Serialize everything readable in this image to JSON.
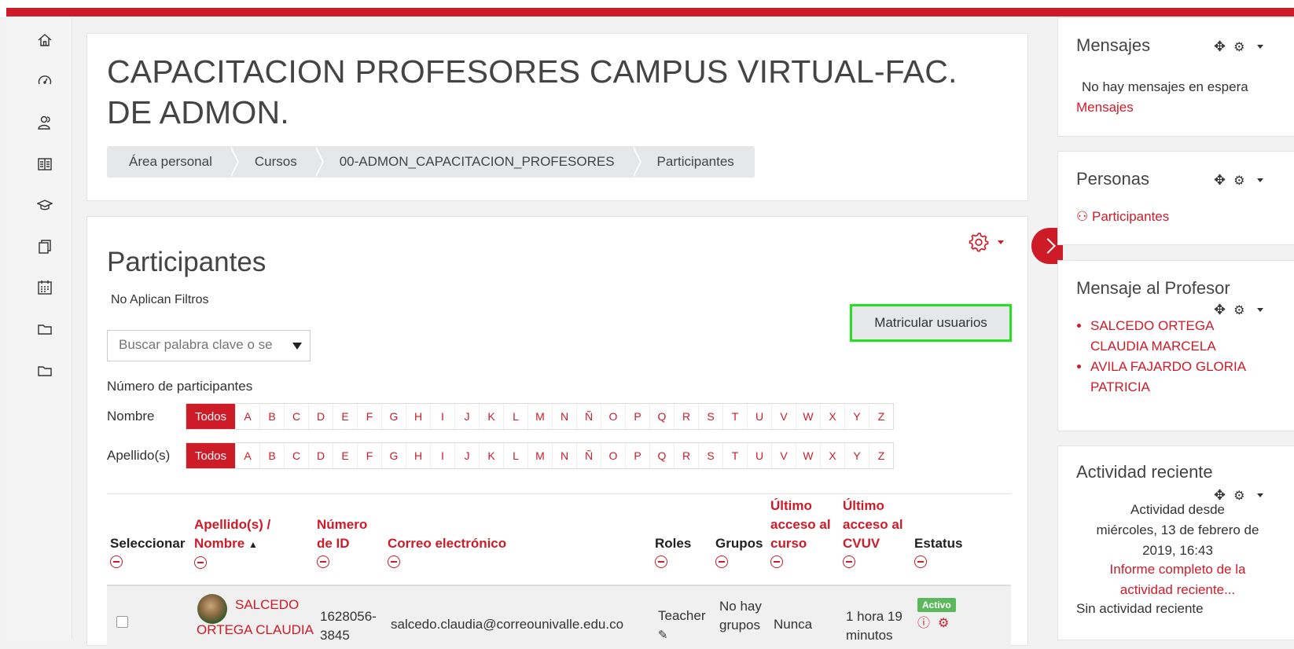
{
  "course": {
    "title": "CAPACITACION PROFESORES CAMPUS VIRTUAL-FAC. DE ADMON.",
    "breadcrumb": [
      "Área personal",
      "Cursos",
      "00-ADMON_CAPACITACION_PROFESORES",
      "Participantes"
    ]
  },
  "nav_icons": [
    "home-icon",
    "dashboard-icon",
    "participants-icon",
    "grades-icon",
    "education-icon",
    "resources-icon",
    "calendar-icon",
    "folder-icon",
    "folder-icon"
  ],
  "participants": {
    "heading": "Participantes",
    "no_filters": "No Aplican Filtros",
    "search_placeholder": "Buscar palabra clave o se",
    "enrol_button": "Matricular usuarios",
    "count_label": "Número de participantes",
    "first_name_label": "Nombre",
    "last_name_label": "Apellido(s)",
    "all_label": "Todos",
    "letters": [
      "A",
      "B",
      "C",
      "D",
      "E",
      "F",
      "G",
      "H",
      "I",
      "J",
      "K",
      "L",
      "M",
      "N",
      "Ñ",
      "O",
      "P",
      "Q",
      "R",
      "S",
      "T",
      "U",
      "V",
      "W",
      "X",
      "Y",
      "Z"
    ],
    "columns": {
      "select": "Seleccionar",
      "name_line1": "Apellido(s) /",
      "name_line2": "Nombre",
      "id_line1": "Número",
      "id_line2": "de ID",
      "email": "Correo electrónico",
      "roles": "Roles",
      "groups": "Grupos",
      "course_access_line1": "Último",
      "course_access_line2": "acceso al",
      "course_access_line3": "curso",
      "cvuv_access_line1": "Último",
      "cvuv_access_line2": "acceso al",
      "cvuv_access_line3": "CVUV",
      "status": "Estatus"
    },
    "row": {
      "name_line1": "SALCEDO",
      "name_line2": "ORTEGA CLAUDIA",
      "id_line1": "1628056-",
      "id_line2": "3845",
      "email": "salcedo.claudia@correounivalle.edu.co",
      "role": "Teacher",
      "groups_line1": "No hay",
      "groups_line2": "grupos",
      "course_access": "Nunca",
      "cvuv_access_line1": "1 hora 19",
      "cvuv_access_line2": "minutos",
      "status": "Activo"
    }
  },
  "blocks": {
    "messages": {
      "title": "Mensajes",
      "text": "No hay mensajes en espera",
      "link": "Mensajes"
    },
    "people": {
      "title": "Personas",
      "link": "Participantes"
    },
    "teacher_msg": {
      "title": "Mensaje al Profesor",
      "items": [
        "SALCEDO ORTEGA CLAUDIA MARCELA",
        "AVILA FAJARDO GLORIA PATRICIA"
      ]
    },
    "recent": {
      "title": "Actividad reciente",
      "since_line1": "Actividad desde",
      "since_line2": "miércoles, 13 de febrero de",
      "since_line3": "2019, 16:43",
      "report_line1": "Informe completo de la",
      "report_line2": "actividad reciente...",
      "none": "Sin actividad reciente"
    }
  },
  "colors": {
    "accent": "#ce1b28",
    "highlight_border": "#22e022",
    "badge": "#5cb85c"
  }
}
